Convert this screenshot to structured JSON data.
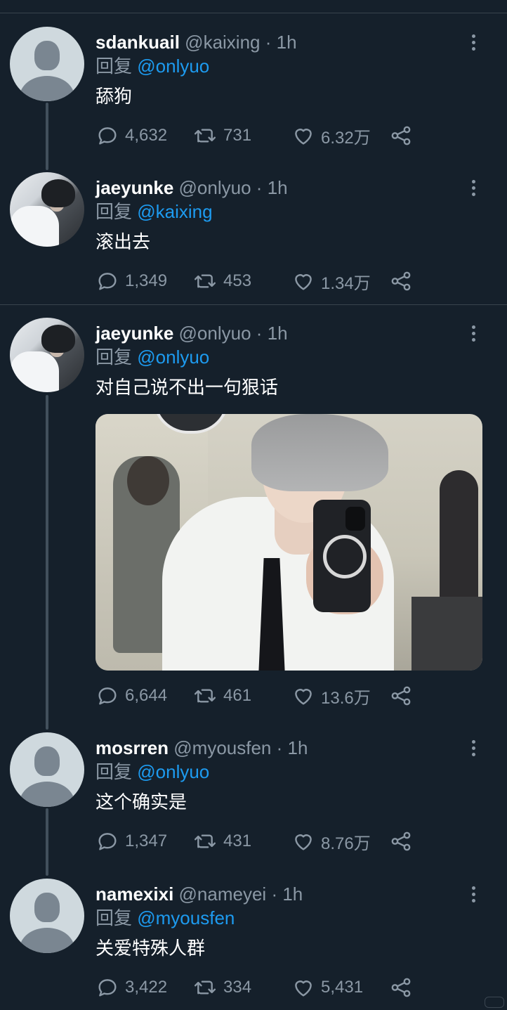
{
  "tweets": [
    {
      "name": "sdankuail",
      "handle": "@kaixing",
      "dot": "·",
      "time": "1h",
      "reply_prefix": "回复",
      "reply_to": "@onlyuo",
      "text": "舔狗",
      "avatar": "default-avatar-icon",
      "replies": "4,632",
      "retweets": "731",
      "likes": "6.32万"
    },
    {
      "name": "jaeyunke",
      "handle": "@onlyuo",
      "dot": "·",
      "time": "1h",
      "reply_prefix": "回复",
      "reply_to": "@kaixing",
      "text": "滚出去",
      "avatar": "photo-avatar",
      "replies": "1,349",
      "retweets": "453",
      "likes": "1.34万"
    },
    {
      "name": "jaeyunke",
      "handle": "@onlyuo",
      "dot": "·",
      "time": "1h",
      "reply_prefix": "回复",
      "reply_to": "@onlyuo",
      "text": "对自己说不出一句狠话",
      "avatar": "photo-avatar",
      "has_media": true,
      "replies": "6,644",
      "retweets": "461",
      "likes": "13.6万"
    },
    {
      "name": "mosrren",
      "handle": "@myousfen",
      "dot": "·",
      "time": "1h",
      "reply_prefix": "回复",
      "reply_to": "@onlyuo",
      "text": "这个确实是",
      "avatar": "default-avatar-icon",
      "replies": "1,347",
      "retweets": "431",
      "likes": "8.76万"
    },
    {
      "name": "namexixi",
      "handle": "@nameyei",
      "dot": "·",
      "time": "1h",
      "reply_prefix": "回复",
      "reply_to": "@myousfen",
      "text": "关爱特殊人群",
      "avatar": "default-avatar-icon",
      "replies": "3,422",
      "retweets": "334",
      "likes": "5,431"
    }
  ],
  "colors": {
    "background": "#15202b",
    "secondary_text": "#8b98a5",
    "mention": "#1d9bf0",
    "divider": "#38444d"
  },
  "icons": [
    "reply-icon",
    "retweet-icon",
    "like-icon",
    "share-icon",
    "more-icon"
  ]
}
